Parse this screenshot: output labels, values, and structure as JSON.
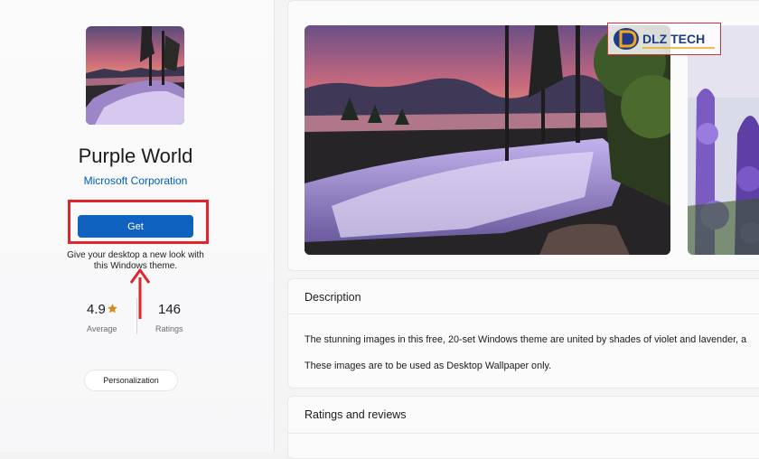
{
  "app": {
    "name": "Purple World",
    "publisher": "Microsoft Corporation",
    "get_label": "Get",
    "short_description": "Give your desktop a new look with this Windows theme.",
    "rating": "4.9",
    "rating_caption": "Average",
    "ratings_count": "146",
    "ratings_caption": "Ratings",
    "category": "Personalization"
  },
  "description": {
    "heading": "Description",
    "line1": "The stunning images in this free, 20-set Windows theme are united by shades of violet and lavender, a",
    "line2": "These images are to be used as Desktop Wallpaper only."
  },
  "reviews": {
    "heading": "Ratings and reviews"
  },
  "watermark": {
    "brand": "DLZ TECH",
    "letter": "D"
  },
  "colors": {
    "accent": "#0f62c0",
    "highlight": "#e0262c",
    "star": "#d8891f",
    "link": "#005fb8"
  }
}
